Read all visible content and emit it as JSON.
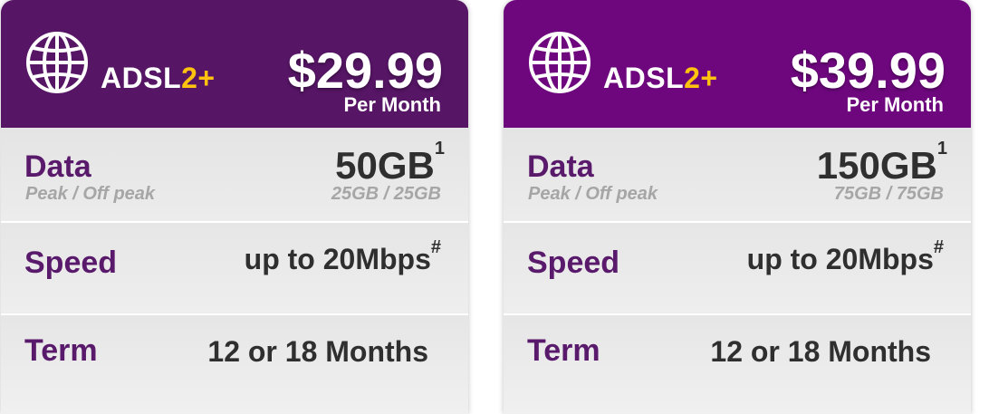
{
  "plans": [
    {
      "product_name": "ADSL",
      "product_suffix": "2+",
      "price": "$29.99",
      "price_period": "Per Month",
      "header_color": "#561565",
      "data_label": "Data",
      "data_sublabel": "Peak / Off peak",
      "data_value": "50GB",
      "data_footnote": "1",
      "data_split": "25GB / 25GB",
      "speed_label": "Speed",
      "speed_value": "up to 20Mbps",
      "speed_footnote": "#",
      "term_label": "Term",
      "term_value": "12 or 18 Months"
    },
    {
      "product_name": "ADSL",
      "product_suffix": "2+",
      "price": "$39.99",
      "price_period": "Per Month",
      "header_color": "#6e077e",
      "data_label": "Data",
      "data_sublabel": "Peak / Off peak",
      "data_value": "150GB",
      "data_footnote": "1",
      "data_split": "75GB / 75GB",
      "speed_label": "Speed",
      "speed_value": "up to 20Mbps",
      "speed_footnote": "#",
      "term_label": "Term",
      "term_value": "12 or 18 Months"
    }
  ],
  "colors": {
    "accent_yellow": "#ffc20e",
    "label_purple": "#5a1a6c",
    "value_dark": "#2f2f2f",
    "muted_gray": "#a6a6a6"
  },
  "icons": {
    "header_icon": "globe-icon"
  }
}
